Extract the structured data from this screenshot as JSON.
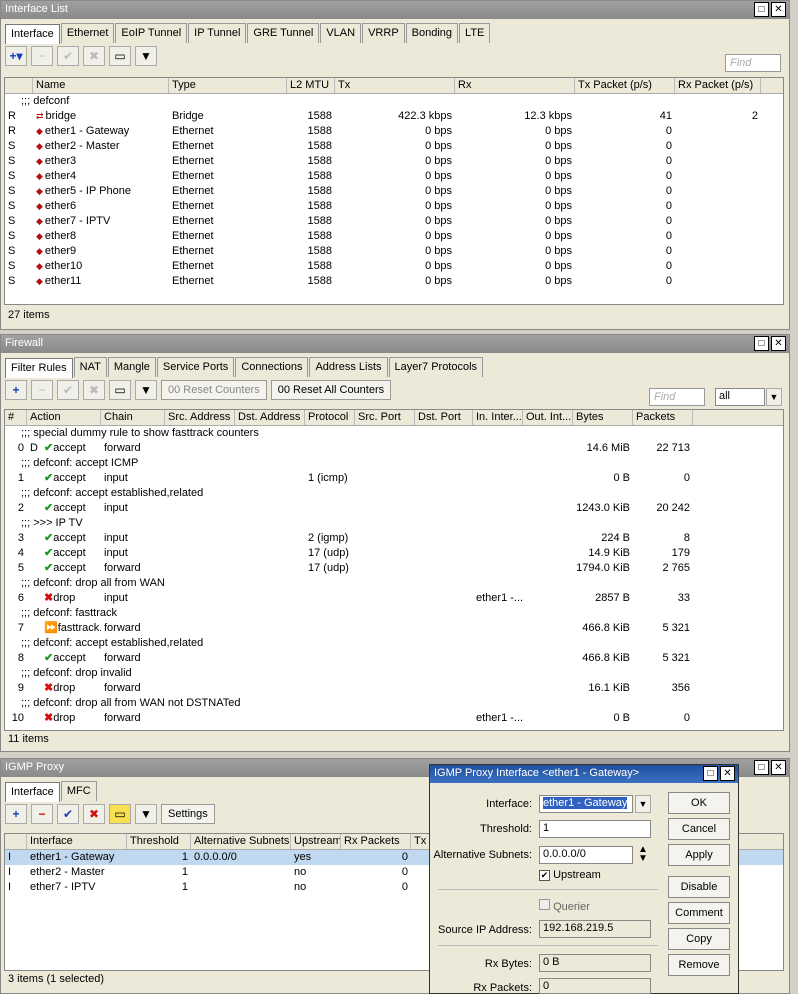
{
  "iface": {
    "title": "Interface List",
    "tabs": [
      "Interface",
      "Ethernet",
      "EoIP Tunnel",
      "IP Tunnel",
      "GRE Tunnel",
      "VLAN",
      "VRRP",
      "Bonding",
      "LTE"
    ],
    "find": "Find",
    "cols": [
      "Name",
      "Type",
      "L2 MTU",
      "Tx",
      "Rx",
      "Tx Packet (p/s)",
      "Rx Packet (p/s)"
    ],
    "comment": ";;; defconf",
    "rows": [
      [
        "R",
        "bridge",
        "Bridge",
        "1588",
        "422.3 kbps",
        "12.3 kbps",
        "41",
        "2"
      ],
      [
        "R",
        "ether1 - Gateway",
        "Ethernet",
        "1588",
        "0 bps",
        "0 bps",
        "0",
        ""
      ],
      [
        "S",
        "ether2 - Master",
        "Ethernet",
        "1588",
        "0 bps",
        "0 bps",
        "0",
        ""
      ],
      [
        "S",
        "ether3",
        "Ethernet",
        "1588",
        "0 bps",
        "0 bps",
        "0",
        ""
      ],
      [
        "S",
        "ether4",
        "Ethernet",
        "1588",
        "0 bps",
        "0 bps",
        "0",
        ""
      ],
      [
        "S",
        "ether5 - IP Phone",
        "Ethernet",
        "1588",
        "0 bps",
        "0 bps",
        "0",
        ""
      ],
      [
        "S",
        "ether6",
        "Ethernet",
        "1588",
        "0 bps",
        "0 bps",
        "0",
        ""
      ],
      [
        "S",
        "ether7 - IPTV",
        "Ethernet",
        "1588",
        "0 bps",
        "0 bps",
        "0",
        ""
      ],
      [
        "S",
        "ether8",
        "Ethernet",
        "1588",
        "0 bps",
        "0 bps",
        "0",
        ""
      ],
      [
        "S",
        "ether9",
        "Ethernet",
        "1588",
        "0 bps",
        "0 bps",
        "0",
        ""
      ],
      [
        "S",
        "ether10",
        "Ethernet",
        "1588",
        "0 bps",
        "0 bps",
        "0",
        ""
      ],
      [
        "S",
        "ether11",
        "Ethernet",
        "1588",
        "0 bps",
        "0 bps",
        "0",
        ""
      ]
    ],
    "status": "27 items"
  },
  "fw": {
    "title": "Firewall",
    "tabs": [
      "Filter Rules",
      "NAT",
      "Mangle",
      "Service Ports",
      "Connections",
      "Address Lists",
      "Layer7 Protocols"
    ],
    "reset": "Reset Counters",
    "reset_all": "Reset All Counters",
    "find": "Find",
    "all": "all",
    "cols": [
      "#",
      "Action",
      "Chain",
      "Src. Address",
      "Dst. Address",
      "Protocol",
      "Src. Port",
      "Dst. Port",
      "In. Inter...",
      "Out. Int...",
      "Bytes",
      "Packets"
    ],
    "items": [
      {
        "c": ";;; special dummy rule to show fasttrack counters"
      },
      {
        "n": "0",
        "f": "D",
        "a": "accept",
        "i": "check",
        "ch": "forward",
        "p": "",
        "in": "",
        "b": "14.6 MiB",
        "k": "22 713"
      },
      {
        "c": ";;; defconf: accept ICMP"
      },
      {
        "n": "1",
        "f": "",
        "a": "accept",
        "i": "check",
        "ch": "input",
        "p": "1 (icmp)",
        "in": "",
        "b": "0 B",
        "k": "0"
      },
      {
        "c": ";;; defconf: accept established,related"
      },
      {
        "n": "2",
        "f": "",
        "a": "accept",
        "i": "check",
        "ch": "input",
        "p": "",
        "in": "",
        "b": "1243.0 KiB",
        "k": "20 242"
      },
      {
        "c": ";;; >>> IP TV"
      },
      {
        "n": "3",
        "f": "",
        "a": "accept",
        "i": "check",
        "ch": "input",
        "p": "2 (igmp)",
        "in": "",
        "b": "224 B",
        "k": "8"
      },
      {
        "n": "4",
        "f": "",
        "a": "accept",
        "i": "check",
        "ch": "input",
        "p": "17 (udp)",
        "in": "",
        "b": "14.9 KiB",
        "k": "179"
      },
      {
        "n": "5",
        "f": "",
        "a": "accept",
        "i": "check",
        "ch": "forward",
        "p": "17 (udp)",
        "in": "",
        "b": "1794.0 KiB",
        "k": "2 765"
      },
      {
        "c": ";;; defconf: drop all from WAN"
      },
      {
        "n": "6",
        "f": "",
        "a": "drop",
        "i": "x",
        "ch": "input",
        "p": "",
        "in": "ether1 -...",
        "b": "2857 B",
        "k": "33"
      },
      {
        "c": ";;; defconf: fasttrack"
      },
      {
        "n": "7",
        "f": "",
        "a": "fasttrack...",
        "i": "ff",
        "ch": "forward",
        "p": "",
        "in": "",
        "b": "466.8 KiB",
        "k": "5 321"
      },
      {
        "c": ";;; defconf: accept established,related"
      },
      {
        "n": "8",
        "f": "",
        "a": "accept",
        "i": "check",
        "ch": "forward",
        "p": "",
        "in": "",
        "b": "466.8 KiB",
        "k": "5 321"
      },
      {
        "c": ";;; defconf: drop invalid"
      },
      {
        "n": "9",
        "f": "",
        "a": "drop",
        "i": "x",
        "ch": "forward",
        "p": "",
        "in": "",
        "b": "16.1 KiB",
        "k": "356"
      },
      {
        "c": ";;; defconf:  drop all from WAN not DSTNATed"
      },
      {
        "n": "10",
        "f": "",
        "a": "drop",
        "i": "x",
        "ch": "forward",
        "p": "",
        "in": "ether1 -...",
        "b": "0 B",
        "k": "0"
      }
    ],
    "status": "11 items"
  },
  "igmp": {
    "title": "IGMP Proxy",
    "tabs": [
      "Interface",
      "MFC"
    ],
    "settings": "Settings",
    "find": "Find",
    "cols": [
      "Interface",
      "Threshold",
      "Alternative Subnets",
      "Upstream",
      "Rx Packets",
      "Tx"
    ],
    "rows": [
      [
        "I",
        "ether1 - Gateway",
        "1",
        "0.0.0.0/0",
        "yes",
        "0"
      ],
      [
        "I",
        "ether2 - Master",
        "1",
        "",
        "no",
        "0"
      ],
      [
        "I",
        "ether7 - IPTV",
        "1",
        "",
        "no",
        "0"
      ]
    ],
    "status": "3 items (1 selected)"
  },
  "dlg": {
    "title": "IGMP Proxy Interface <ether1 - Gateway>",
    "l_iface": "Interface:",
    "v_iface": "ether1 - Gateway",
    "l_thr": "Threshold:",
    "v_thr": "1",
    "l_alt": "Alternative Subnets:",
    "v_alt": "0.0.0.0/0",
    "l_up": "Upstream",
    "l_q": "Querier",
    "l_src": "Source IP Address:",
    "v_src": "192.168.219.5",
    "l_rxb": "Rx Bytes:",
    "v_rxb": "0 B",
    "l_rxp": "Rx Packets:",
    "v_rxp": "0",
    "ok": "OK",
    "cancel": "Cancel",
    "apply": "Apply",
    "disable": "Disable",
    "comment": "Comment",
    "copy": "Copy",
    "remove": "Remove"
  }
}
